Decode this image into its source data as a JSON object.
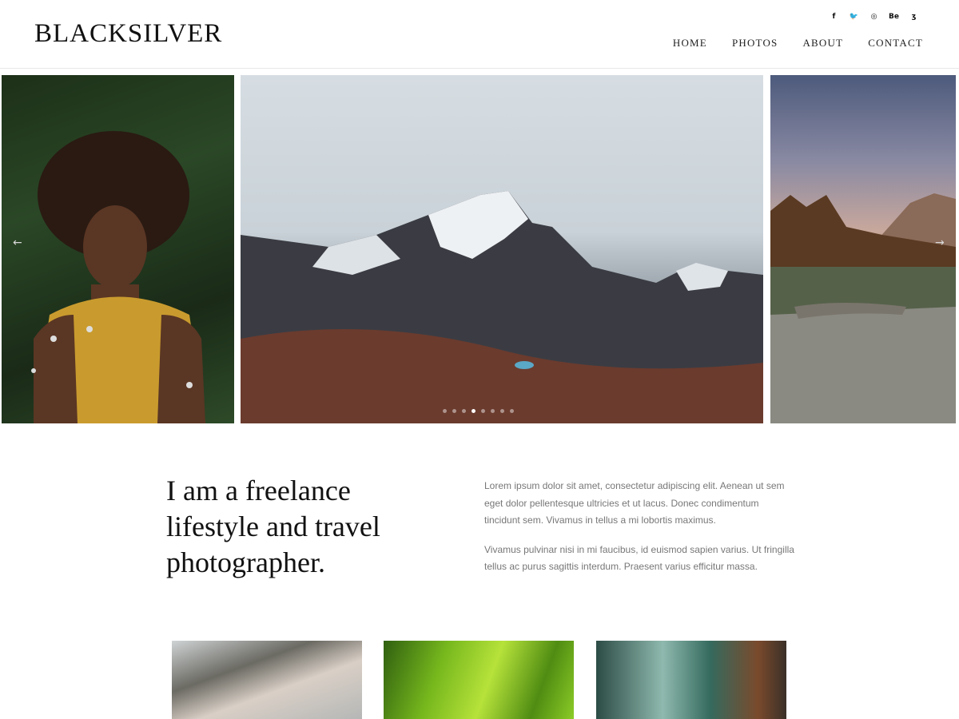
{
  "brand": {
    "logo": "BLACKSILVER"
  },
  "social": [
    {
      "name": "facebook-icon",
      "glyph": "f"
    },
    {
      "name": "twitter-icon",
      "glyph": "🐦"
    },
    {
      "name": "instagram-icon",
      "glyph": "◎"
    },
    {
      "name": "behance-icon",
      "glyph": "Be"
    },
    {
      "name": "500px-icon",
      "glyph": "ʒ"
    }
  ],
  "nav": [
    "HOME",
    "PHOTOS",
    "ABOUT",
    "CONTACT"
  ],
  "slider": {
    "prev_arrow": "←",
    "next_arrow": "→",
    "dot_count": 8,
    "active_dot": 4
  },
  "intro": {
    "headline": "I am a freelance lifestyle and travel photographer.",
    "paragraphs": [
      "Lorem ipsum dolor sit amet, consectetur adipiscing elit. Aenean ut sem eget dolor pellentesque ultricies et ut lacus. Donec condimentum tincidunt sem. Vivamus in tellus a mi lobortis maximus.",
      "Vivamus pulvinar nisi in mi faucibus, id euismod sapien varius. Ut fringilla tellus ac purus sagittis interdum. Praesent varius efficitur massa."
    ]
  }
}
